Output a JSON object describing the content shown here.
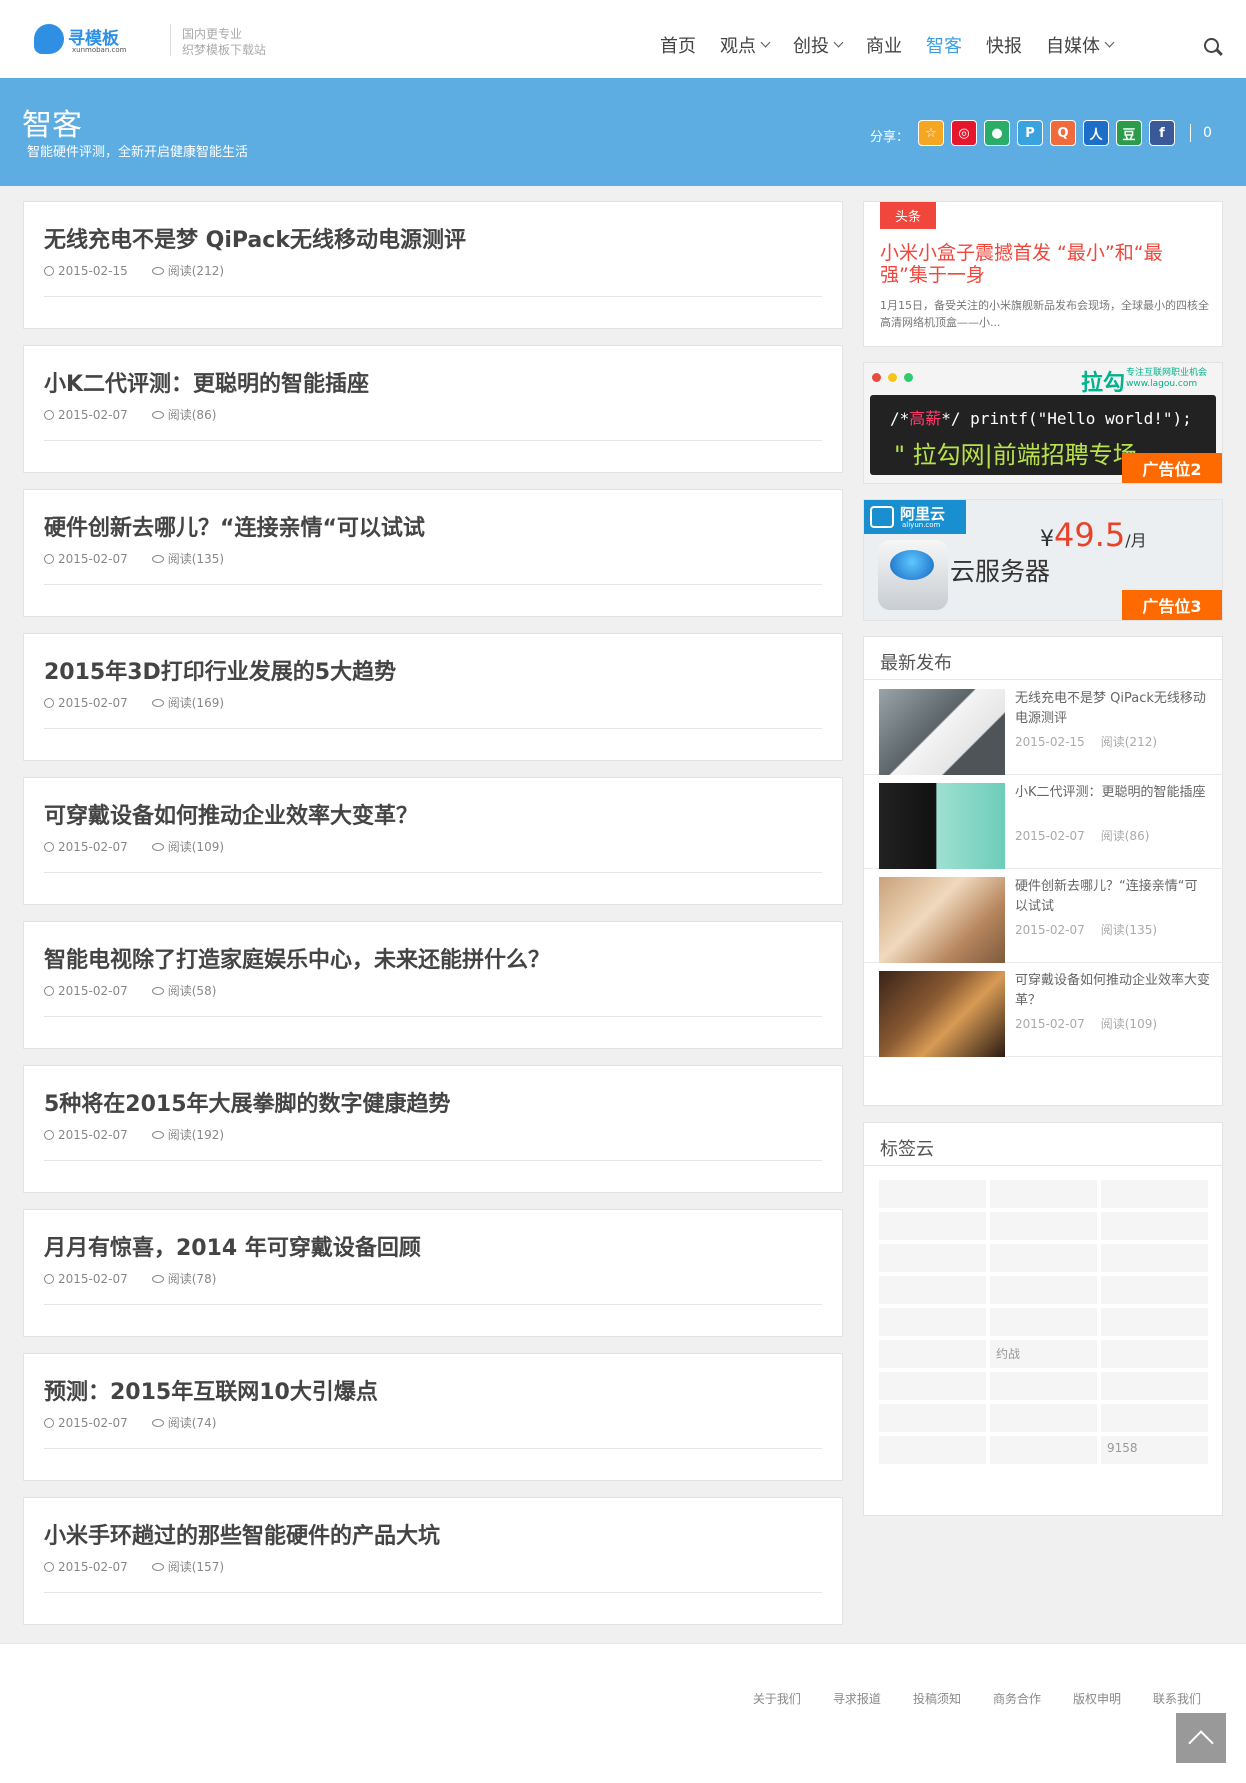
{
  "site": {
    "logo_name": "寻模板",
    "logo_domain": "xunmoban.com",
    "tagline_1": "国内更专业",
    "tagline_2": "织梦模板下载站"
  },
  "nav": {
    "items": [
      {
        "label": "首页",
        "dropdown": false,
        "active": false
      },
      {
        "label": "观点",
        "dropdown": true,
        "active": false
      },
      {
        "label": "创投",
        "dropdown": true,
        "active": false
      },
      {
        "label": "商业",
        "dropdown": false,
        "active": false
      },
      {
        "label": "智客",
        "dropdown": false,
        "active": true
      },
      {
        "label": "快报",
        "dropdown": false,
        "active": false
      },
      {
        "label": "自媒体",
        "dropdown": true,
        "active": false
      }
    ]
  },
  "banner": {
    "title": "智客",
    "subtitle": "智能硬件评测，全新开启健康智能生活",
    "share_label": "分享：",
    "share_count": "0",
    "share_icons": [
      {
        "name": "qzone-icon",
        "glyph": "☆",
        "bg": "#f5a623"
      },
      {
        "name": "weibo-icon",
        "glyph": "◎",
        "bg": "#e6162d"
      },
      {
        "name": "wechat-icon",
        "glyph": "●",
        "bg": "#2aae67"
      },
      {
        "name": "tencent-weibo-icon",
        "glyph": "P",
        "bg": "#38a3de"
      },
      {
        "name": "qq-icon",
        "glyph": "Q",
        "bg": "#f06b3b"
      },
      {
        "name": "renren-icon",
        "glyph": "人",
        "bg": "#1d6ec9"
      },
      {
        "name": "douban-icon",
        "glyph": "豆",
        "bg": "#2c9c4a"
      },
      {
        "name": "facebook-icon",
        "glyph": "f",
        "bg": "#3b5998"
      }
    ]
  },
  "articles": [
    {
      "title": "无线充电不是梦 QiPack无线移动电源测评",
      "date": "2015-02-15",
      "views": "阅读(212)"
    },
    {
      "title": "小K二代评测：更聪明的智能插座",
      "date": "2015-02-07",
      "views": "阅读(86)"
    },
    {
      "title": "硬件创新去哪儿？“连接亲情“可以试试",
      "date": "2015-02-07",
      "views": "阅读(135)"
    },
    {
      "title": "2015年3D打印行业发展的5大趋势",
      "date": "2015-02-07",
      "views": "阅读(169)"
    },
    {
      "title": "可穿戴设备如何推动企业效率大变革？",
      "date": "2015-02-07",
      "views": "阅读(109)"
    },
    {
      "title": "智能电视除了打造家庭娱乐中心，未来还能拼什么？",
      "date": "2015-02-07",
      "views": "阅读(58)"
    },
    {
      "title": "5种将在2015年大展拳脚的数字健康趋势",
      "date": "2015-02-07",
      "views": "阅读(192)"
    },
    {
      "title": "月月有惊喜，2014 年可穿戴设备回顾",
      "date": "2015-02-07",
      "views": "阅读(78)"
    },
    {
      "title": "预测：2015年互联网10大引爆点",
      "date": "2015-02-07",
      "views": "阅读(74)"
    },
    {
      "title": "小米手环趟过的那些智能硬件的产品大坑",
      "date": "2015-02-07",
      "views": "阅读(157)"
    }
  ],
  "headline": {
    "tag": "头条",
    "title": "小米小盒子震撼首发 “最小”和“最强”集于一身",
    "desc": "1月15日，备受关注的小米旗舰新品发布会现场，全球最小的四核全高清网络机顶盒——小..."
  },
  "ad2": {
    "brand": "拉勾",
    "brand_sub_1": "专注互联网职业机会",
    "brand_sub_2": "www.lagou.com",
    "code_prefix": "/*",
    "code_highlight": "高薪",
    "code_suffix": "*/ printf(\"Hello world!\");",
    "code_line2": "\" 拉勾网|前端招聘专场",
    "label": "广告位2"
  },
  "ad3": {
    "brand": "阿里云",
    "brand_domain": "aliyun.com",
    "price_symbol": "¥",
    "price": "49.5",
    "price_unit": "/月",
    "product": "云服务器",
    "label": "广告位3"
  },
  "recent": {
    "title": "最新发布",
    "items": [
      {
        "title": "无线充电不是梦 QiPack无线移动电源测评",
        "date": "2015-02-15",
        "views": "阅读(212)"
      },
      {
        "title": "小K二代评测：更聪明的智能插座",
        "date": "2015-02-07",
        "views": "阅读(86)"
      },
      {
        "title": "硬件创新去哪儿？“连接亲情“可以试试",
        "date": "2015-02-07",
        "views": "阅读(135)"
      },
      {
        "title": "可穿戴设备如何推动企业效率大变革？",
        "date": "2015-02-07",
        "views": "阅读(109)"
      }
    ]
  },
  "tags": {
    "title": "标签云",
    "cells": [
      "",
      "",
      "",
      "",
      "",
      "",
      "",
      "",
      "",
      "",
      "",
      "",
      "",
      "",
      "",
      "",
      "约战",
      "",
      "",
      "",
      "",
      "",
      "",
      "",
      "",
      "",
      "9158"
    ]
  },
  "footer": {
    "links": [
      "关于我们",
      "寻求报道",
      "投稿须知",
      "商务合作",
      "版权申明",
      "联系我们"
    ]
  },
  "colors": {
    "accent": "#5dade2",
    "nav_active": "#3ea0e2",
    "headline_red": "#f0463b",
    "ad_orange": "#ff6a00"
  }
}
